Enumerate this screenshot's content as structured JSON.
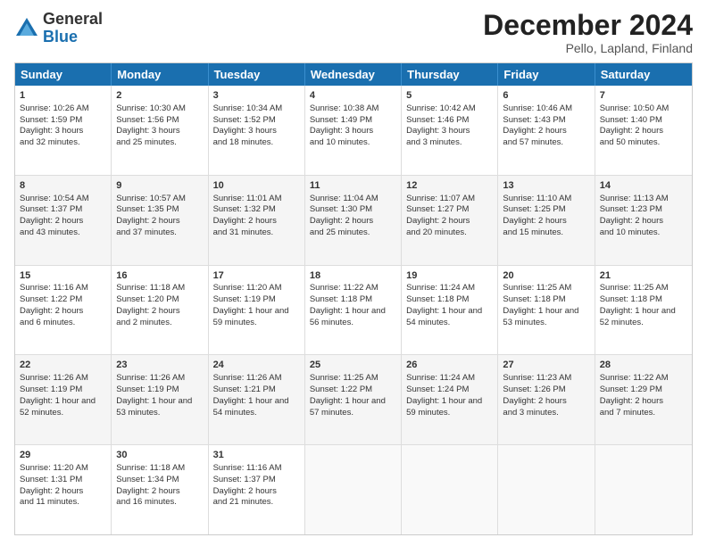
{
  "logo": {
    "general": "General",
    "blue": "Blue"
  },
  "title": "December 2024",
  "subtitle": "Pello, Lapland, Finland",
  "days": [
    "Sunday",
    "Monday",
    "Tuesday",
    "Wednesday",
    "Thursday",
    "Friday",
    "Saturday"
  ],
  "weeks": [
    [
      {
        "day": "1",
        "lines": [
          "Sunrise: 10:26 AM",
          "Sunset: 1:59 PM",
          "Daylight: 3 hours",
          "and 32 minutes."
        ]
      },
      {
        "day": "2",
        "lines": [
          "Sunrise: 10:30 AM",
          "Sunset: 1:56 PM",
          "Daylight: 3 hours",
          "and 25 minutes."
        ]
      },
      {
        "day": "3",
        "lines": [
          "Sunrise: 10:34 AM",
          "Sunset: 1:52 PM",
          "Daylight: 3 hours",
          "and 18 minutes."
        ]
      },
      {
        "day": "4",
        "lines": [
          "Sunrise: 10:38 AM",
          "Sunset: 1:49 PM",
          "Daylight: 3 hours",
          "and 10 minutes."
        ]
      },
      {
        "day": "5",
        "lines": [
          "Sunrise: 10:42 AM",
          "Sunset: 1:46 PM",
          "Daylight: 3 hours",
          "and 3 minutes."
        ]
      },
      {
        "day": "6",
        "lines": [
          "Sunrise: 10:46 AM",
          "Sunset: 1:43 PM",
          "Daylight: 2 hours",
          "and 57 minutes."
        ]
      },
      {
        "day": "7",
        "lines": [
          "Sunrise: 10:50 AM",
          "Sunset: 1:40 PM",
          "Daylight: 2 hours",
          "and 50 minutes."
        ]
      }
    ],
    [
      {
        "day": "8",
        "lines": [
          "Sunrise: 10:54 AM",
          "Sunset: 1:37 PM",
          "Daylight: 2 hours",
          "and 43 minutes."
        ]
      },
      {
        "day": "9",
        "lines": [
          "Sunrise: 10:57 AM",
          "Sunset: 1:35 PM",
          "Daylight: 2 hours",
          "and 37 minutes."
        ]
      },
      {
        "day": "10",
        "lines": [
          "Sunrise: 11:01 AM",
          "Sunset: 1:32 PM",
          "Daylight: 2 hours",
          "and 31 minutes."
        ]
      },
      {
        "day": "11",
        "lines": [
          "Sunrise: 11:04 AM",
          "Sunset: 1:30 PM",
          "Daylight: 2 hours",
          "and 25 minutes."
        ]
      },
      {
        "day": "12",
        "lines": [
          "Sunrise: 11:07 AM",
          "Sunset: 1:27 PM",
          "Daylight: 2 hours",
          "and 20 minutes."
        ]
      },
      {
        "day": "13",
        "lines": [
          "Sunrise: 11:10 AM",
          "Sunset: 1:25 PM",
          "Daylight: 2 hours",
          "and 15 minutes."
        ]
      },
      {
        "day": "14",
        "lines": [
          "Sunrise: 11:13 AM",
          "Sunset: 1:23 PM",
          "Daylight: 2 hours",
          "and 10 minutes."
        ]
      }
    ],
    [
      {
        "day": "15",
        "lines": [
          "Sunrise: 11:16 AM",
          "Sunset: 1:22 PM",
          "Daylight: 2 hours",
          "and 6 minutes."
        ]
      },
      {
        "day": "16",
        "lines": [
          "Sunrise: 11:18 AM",
          "Sunset: 1:20 PM",
          "Daylight: 2 hours",
          "and 2 minutes."
        ]
      },
      {
        "day": "17",
        "lines": [
          "Sunrise: 11:20 AM",
          "Sunset: 1:19 PM",
          "Daylight: 1 hour and",
          "59 minutes."
        ]
      },
      {
        "day": "18",
        "lines": [
          "Sunrise: 11:22 AM",
          "Sunset: 1:18 PM",
          "Daylight: 1 hour and",
          "56 minutes."
        ]
      },
      {
        "day": "19",
        "lines": [
          "Sunrise: 11:24 AM",
          "Sunset: 1:18 PM",
          "Daylight: 1 hour and",
          "54 minutes."
        ]
      },
      {
        "day": "20",
        "lines": [
          "Sunrise: 11:25 AM",
          "Sunset: 1:18 PM",
          "Daylight: 1 hour and",
          "53 minutes."
        ]
      },
      {
        "day": "21",
        "lines": [
          "Sunrise: 11:25 AM",
          "Sunset: 1:18 PM",
          "Daylight: 1 hour and",
          "52 minutes."
        ]
      }
    ],
    [
      {
        "day": "22",
        "lines": [
          "Sunrise: 11:26 AM",
          "Sunset: 1:19 PM",
          "Daylight: 1 hour and",
          "52 minutes."
        ]
      },
      {
        "day": "23",
        "lines": [
          "Sunrise: 11:26 AM",
          "Sunset: 1:19 PM",
          "Daylight: 1 hour and",
          "53 minutes."
        ]
      },
      {
        "day": "24",
        "lines": [
          "Sunrise: 11:26 AM",
          "Sunset: 1:21 PM",
          "Daylight: 1 hour and",
          "54 minutes."
        ]
      },
      {
        "day": "25",
        "lines": [
          "Sunrise: 11:25 AM",
          "Sunset: 1:22 PM",
          "Daylight: 1 hour and",
          "57 minutes."
        ]
      },
      {
        "day": "26",
        "lines": [
          "Sunrise: 11:24 AM",
          "Sunset: 1:24 PM",
          "Daylight: 1 hour and",
          "59 minutes."
        ]
      },
      {
        "day": "27",
        "lines": [
          "Sunrise: 11:23 AM",
          "Sunset: 1:26 PM",
          "Daylight: 2 hours",
          "and 3 minutes."
        ]
      },
      {
        "day": "28",
        "lines": [
          "Sunrise: 11:22 AM",
          "Sunset: 1:29 PM",
          "Daylight: 2 hours",
          "and 7 minutes."
        ]
      }
    ],
    [
      {
        "day": "29",
        "lines": [
          "Sunrise: 11:20 AM",
          "Sunset: 1:31 PM",
          "Daylight: 2 hours",
          "and 11 minutes."
        ]
      },
      {
        "day": "30",
        "lines": [
          "Sunrise: 11:18 AM",
          "Sunset: 1:34 PM",
          "Daylight: 2 hours",
          "and 16 minutes."
        ]
      },
      {
        "day": "31",
        "lines": [
          "Sunrise: 11:16 AM",
          "Sunset: 1:37 PM",
          "Daylight: 2 hours",
          "and 21 minutes."
        ]
      },
      null,
      null,
      null,
      null
    ]
  ]
}
